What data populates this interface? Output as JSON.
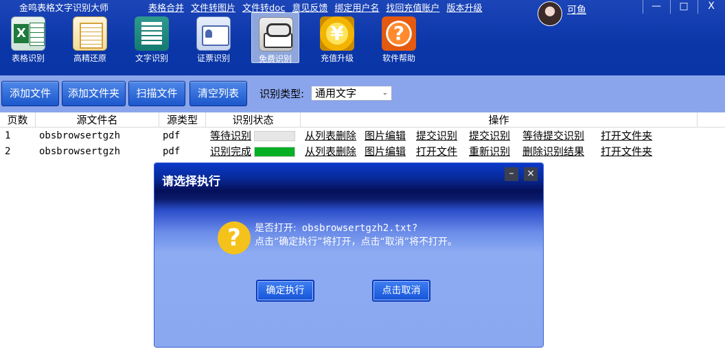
{
  "app": {
    "title": "金鸣表格文字识别大师"
  },
  "top_links": [
    "表格合并",
    "文件转图片",
    "文件转doc",
    "意见反馈",
    "绑定用户名",
    "找回充值账户",
    "版本升级"
  ],
  "user": {
    "name": "可鱼"
  },
  "window_controls": {
    "minimize": "—",
    "maximize": "□",
    "close": "X"
  },
  "toolbar": [
    {
      "label": "表格识别",
      "icon": "excel-icon"
    },
    {
      "label": "高精还原",
      "icon": "document-restore-icon"
    },
    {
      "label": "文字识别",
      "icon": "text-document-icon"
    },
    {
      "label": "证票识别",
      "icon": "id-card-icon"
    },
    {
      "label": "免费识别",
      "icon": "book-icon",
      "active": true
    },
    {
      "label": "充值升级",
      "icon": "yen-coin-icon"
    },
    {
      "label": "软件帮助",
      "icon": "help-icon"
    }
  ],
  "actions": {
    "add_file": "添加文件",
    "add_folder": "添加文件夹",
    "scan_file": "扫描文件",
    "clear_list": "清空列表",
    "type_label": "识别类型:",
    "type_value": "通用文字"
  },
  "table": {
    "headers": [
      "页数",
      "源文件名",
      "源类型",
      "识别状态",
      "操作"
    ],
    "rows": [
      {
        "page": "1",
        "filename": "obsbrowsertgzh",
        "type": "pdf",
        "status": "等待识别",
        "progress": 0,
        "ops": [
          "从列表删除",
          "图片编辑",
          "提交识别",
          "提交识别",
          "等待提交识别",
          "打开文件夹"
        ]
      },
      {
        "page": "2",
        "filename": "obsbrowsertgzh",
        "type": "pdf",
        "status": "识别完成",
        "progress": 1,
        "ops": [
          "从列表删除",
          "图片编辑",
          "打开文件",
          "重新识别",
          "删除识别结果",
          "打开文件夹"
        ]
      }
    ]
  },
  "dialog": {
    "title": "请选择执行",
    "minimize": "–",
    "close": "×",
    "line1_prefix": "是否打开:",
    "line1_file": "obsbrowsertgzh2.txt?",
    "line2": "点击“确定执行”将打开，点击“取消”将不打开。",
    "confirm": "确定执行",
    "cancel": "点击取消"
  },
  "colors": {
    "title_bar": "#0b36a8",
    "action_bar": "#8aa5ec",
    "button_blue": "#1b57cc",
    "progress_green": "#06b025",
    "question_icon": "#f5c21b"
  }
}
